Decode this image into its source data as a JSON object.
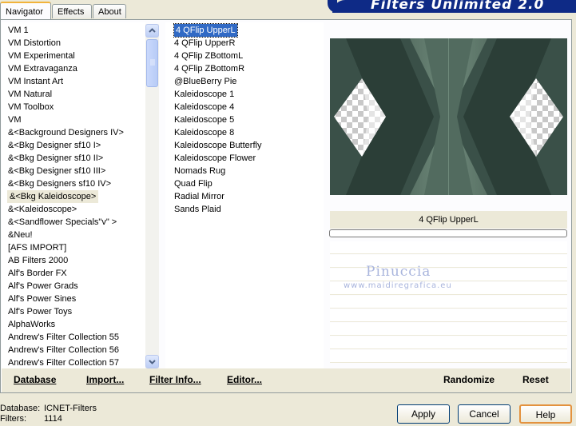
{
  "window": {
    "title": "Filters Unlimited 2.0"
  },
  "tabs": [
    {
      "label": "Navigator",
      "active": true
    },
    {
      "label": "Effects",
      "active": false
    },
    {
      "label": "About",
      "active": false
    }
  ],
  "categories": [
    "VM 1",
    "VM Distortion",
    "VM Experimental",
    "VM Extravaganza",
    "VM Instant Art",
    "VM Natural",
    "VM Toolbox",
    "VM",
    "&<Background Designers IV>",
    "&<Bkg Designer sf10 I>",
    "&<Bkg Designer sf10 II>",
    "&<Bkg Designer sf10 III>",
    "&<Bkg Designers sf10 IV>",
    "&<Bkg Kaleidoscope>",
    "&<Kaleidoscope>",
    "&<Sandflower Specials\"v\" >",
    "&Neu!",
    "[AFS IMPORT]",
    "AB Filters 2000",
    "Alf's Border FX",
    "Alf's Power Grads",
    "Alf's Power Sines",
    "Alf's Power Toys",
    "AlphaWorks",
    "Andrew's Filter Collection 55",
    "Andrew's Filter Collection 56",
    "Andrew's Filter Collection 57"
  ],
  "selected_category": "&<Bkg Kaleidoscope>",
  "filters": [
    "4 QFlip UpperL",
    "4 QFlip UpperR",
    "4 QFlip ZBottomL",
    "4 QFlip ZBottomR",
    "@BlueBerry Pie",
    "Kaleidoscope 1",
    "Kaleidoscope 4",
    "Kaleidoscope 5",
    "Kaleidoscope 8",
    "Kaleidoscope Butterfly",
    "Kaleidoscope Flower",
    "Nomads Rug",
    "Quad Flip",
    "Radial Mirror",
    "Sands Plaid"
  ],
  "selected_filter": "4 QFlip UpperL",
  "preview": {
    "filter_name": "4 QFlip UpperL",
    "progress": 0
  },
  "watermark": {
    "line1": "Pinuccia",
    "line2": "www.maidiregrafica.eu"
  },
  "bottom_links": {
    "database": "Database",
    "import": "Import...",
    "filter_info": "Filter Info...",
    "editor": "Editor...",
    "randomize": "Randomize",
    "reset": "Reset"
  },
  "footer": {
    "database_label": "Database:",
    "database_value": "ICNET-Filters",
    "filters_label": "Filters:",
    "filters_value": "1114"
  },
  "buttons": {
    "apply": "Apply",
    "cancel": "Cancel",
    "help": "Help"
  }
}
